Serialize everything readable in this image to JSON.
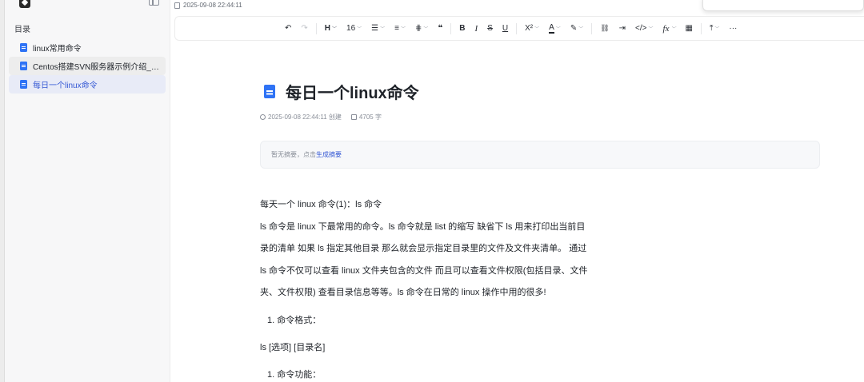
{
  "sidebar": {
    "toc_title": "目录",
    "items": [
      {
        "label": "linux常用命令",
        "state": "normal"
      },
      {
        "label": "Centos搭建SVN服务器示例介绍_一...",
        "state": "hover"
      },
      {
        "label": "每日一个linux命令",
        "state": "active"
      }
    ]
  },
  "header": {
    "timestamp": "2025-09-08 22:44:11"
  },
  "toolbar": {
    "undo": "↶",
    "redo": "↷",
    "heading": "H",
    "font_size": "16",
    "list": "☰",
    "align": "≡",
    "spacing": "⋕",
    "quote": "❝",
    "bold": "B",
    "italic": "I",
    "strike": "S",
    "underline": "U",
    "superscript": "X²",
    "font_color": "A",
    "highlight": "✎",
    "link": "🔗",
    "indent": "⇥",
    "code": "</>",
    "formula": "fx",
    "table": "▦",
    "insert": "⤒",
    "more": "···"
  },
  "document": {
    "title": "每日一个linux命令",
    "created_at": "2025-09-08 22:44:11 创建",
    "word_count": "4705 字",
    "summary_prefix": "暂无摘要，点击",
    "summary_link": "生成摘要",
    "heading_line": "每天一个 linux 命令(1)：ls 命令",
    "paragraph_lines": [
      "ls 命令是 linux 下最常用的命令。ls 命令就是 list 的缩写 缺省下 ls 用来打印出当前目",
      "录的清单 如果 ls 指定其他目录 那么就会显示指定目录里的文件及文件夹清单。 通过",
      "ls 命令不仅可以查看 linux 文件夹包含的文件 而且可以查看文件权限(包括目录、文件",
      "夹、文件权限) 查看目录信息等等。ls 命令在日常的 linux 操作中用的很多!"
    ],
    "list_item_1": "1. 命令格式：",
    "syntax": "ls [选项] [目录名]",
    "list_item_2": "1. 命令功能："
  }
}
